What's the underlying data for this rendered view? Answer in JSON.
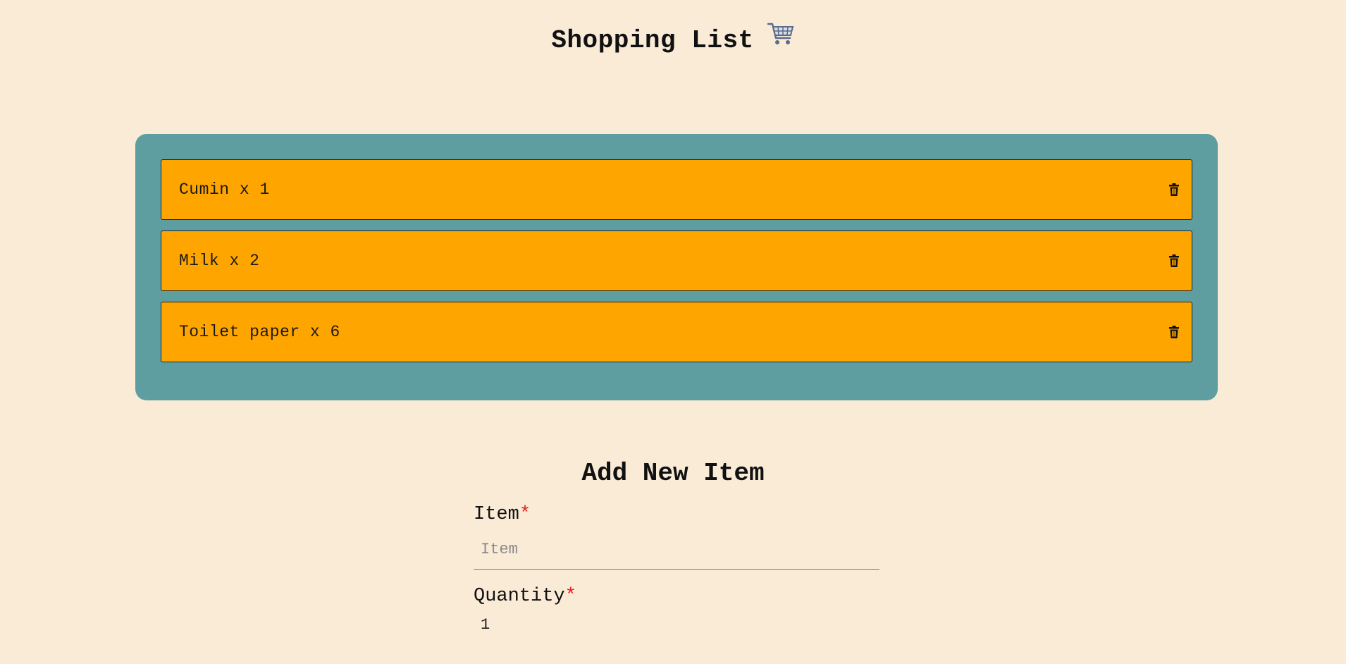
{
  "header": {
    "title": "Shopping List",
    "icon": "shopping-cart-icon"
  },
  "list": {
    "items": [
      {
        "label": "Cumin x 1"
      },
      {
        "label": "Milk x 2"
      },
      {
        "label": "Toilet paper x 6"
      }
    ],
    "delete_icon": "trash-icon"
  },
  "form": {
    "title": "Add New Item",
    "item_label": "Item",
    "required_marker": "*",
    "item_placeholder": "Item",
    "item_value": "",
    "quantity_label": "Quantity",
    "quantity_value": "1"
  },
  "colors": {
    "background": "#faebd7",
    "panel": "#5f9ea0",
    "item": "#ffa500",
    "required": "#e8191b"
  }
}
